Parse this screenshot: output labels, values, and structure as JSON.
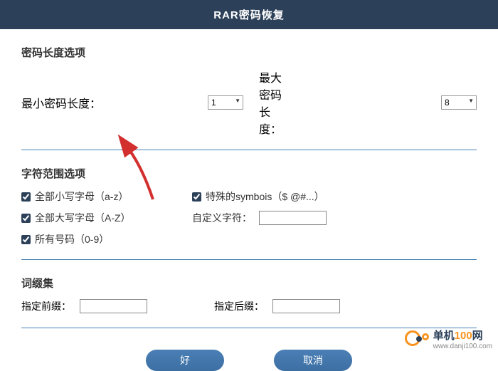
{
  "header": {
    "title": "RAR密码恢复"
  },
  "length_section": {
    "title": "密码长度选项",
    "min_label": "最小密码长度：",
    "min_value": "1",
    "max_label": "最大密码长度：",
    "max_value": "8"
  },
  "charset_section": {
    "title": "字符范围选项",
    "lowercase": {
      "label": "全部小写字母（a-z）",
      "checked": true
    },
    "uppercase": {
      "label": "全部大写字母（A-Z）",
      "checked": true
    },
    "numbers": {
      "label": "所有号码（0-9）",
      "checked": true
    },
    "symbols": {
      "label": "特殊的symbois（$ @#...）",
      "checked": true
    },
    "custom_label": "自定义字符：",
    "custom_value": ""
  },
  "affix_section": {
    "title": "词缀集",
    "prefix_label": "指定前缀：",
    "prefix_value": "",
    "suffix_label": "指定后缀：",
    "suffix_value": ""
  },
  "buttons": {
    "ok": "好",
    "cancel": "取消"
  },
  "watermark": {
    "brand_cn": "单机",
    "brand_num": "100",
    "brand_suffix": "网",
    "url": "www.danji100.com"
  }
}
